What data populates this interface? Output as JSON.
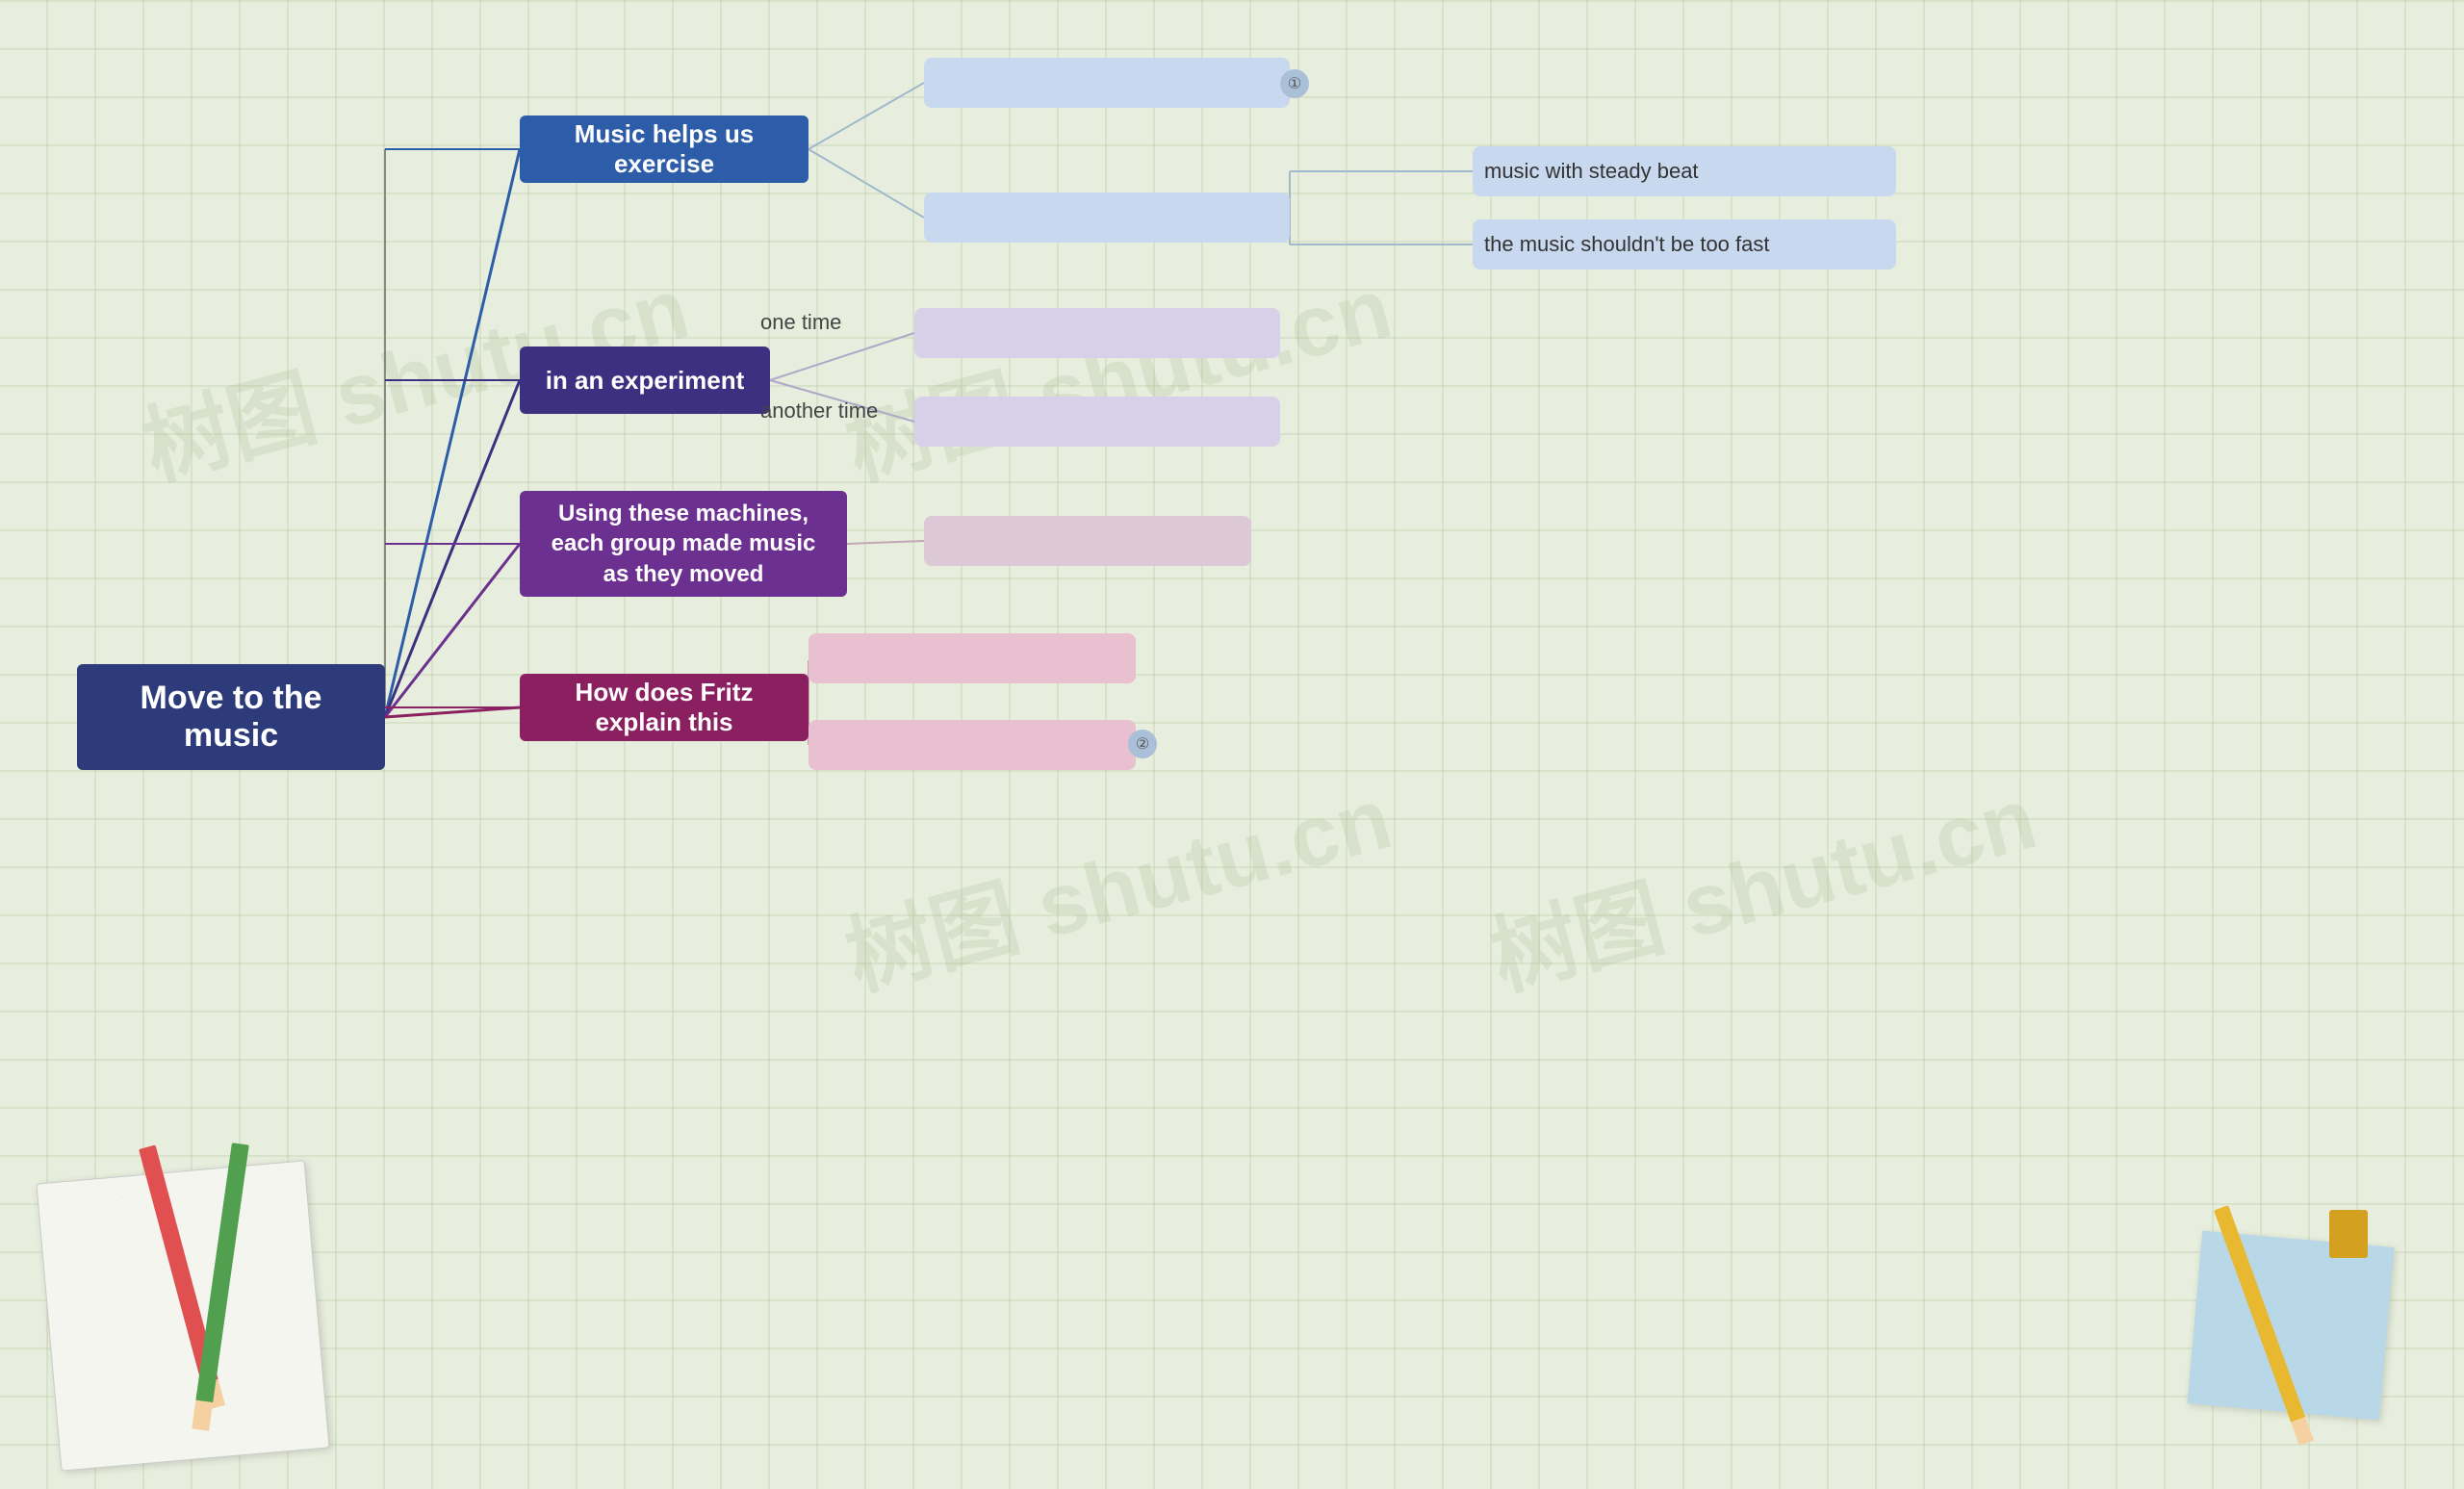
{
  "background": {
    "color": "#e8eedd"
  },
  "watermarks": [
    {
      "text": "树图 shutu.cn"
    },
    {
      "text": "树图 shutu.cn"
    },
    {
      "text": "树图 shutu.cn"
    },
    {
      "text": "树图 shutu.cn"
    }
  ],
  "root": {
    "label": "Move to the music"
  },
  "branches": [
    {
      "id": "branch1",
      "label": "Music helps us exercise",
      "leaves": [
        {
          "id": "leaf1-1",
          "label": "",
          "num": "①"
        },
        {
          "id": "leaf1-2",
          "label": "",
          "subleaves": [
            {
              "id": "leaf1-2a",
              "label": "music with steady beat"
            },
            {
              "id": "leaf1-2b",
              "label": "the music shouldn't be too fast"
            }
          ]
        }
      ]
    },
    {
      "id": "branch2",
      "label": "in an experiment",
      "leaves": [
        {
          "id": "leaf2-1",
          "label": "",
          "prefix": "one time"
        },
        {
          "id": "leaf2-2",
          "label": "",
          "prefix": "another time"
        }
      ]
    },
    {
      "id": "branch3",
      "label": "Using these machines, each group made music as they moved",
      "leaves": [
        {
          "id": "leaf3-1",
          "label": ""
        }
      ]
    },
    {
      "id": "branch4",
      "label": "How does Fritz explain this",
      "leaves": [
        {
          "id": "leaf4-1",
          "label": ""
        },
        {
          "id": "leaf4-2",
          "label": "",
          "num": "②"
        }
      ]
    }
  ],
  "labels": {
    "one_time": "one time",
    "another_time": "another time",
    "music_steady": "music with steady beat",
    "music_fast": "the music shouldn't be too fast",
    "num1": "①",
    "num2": "②"
  }
}
